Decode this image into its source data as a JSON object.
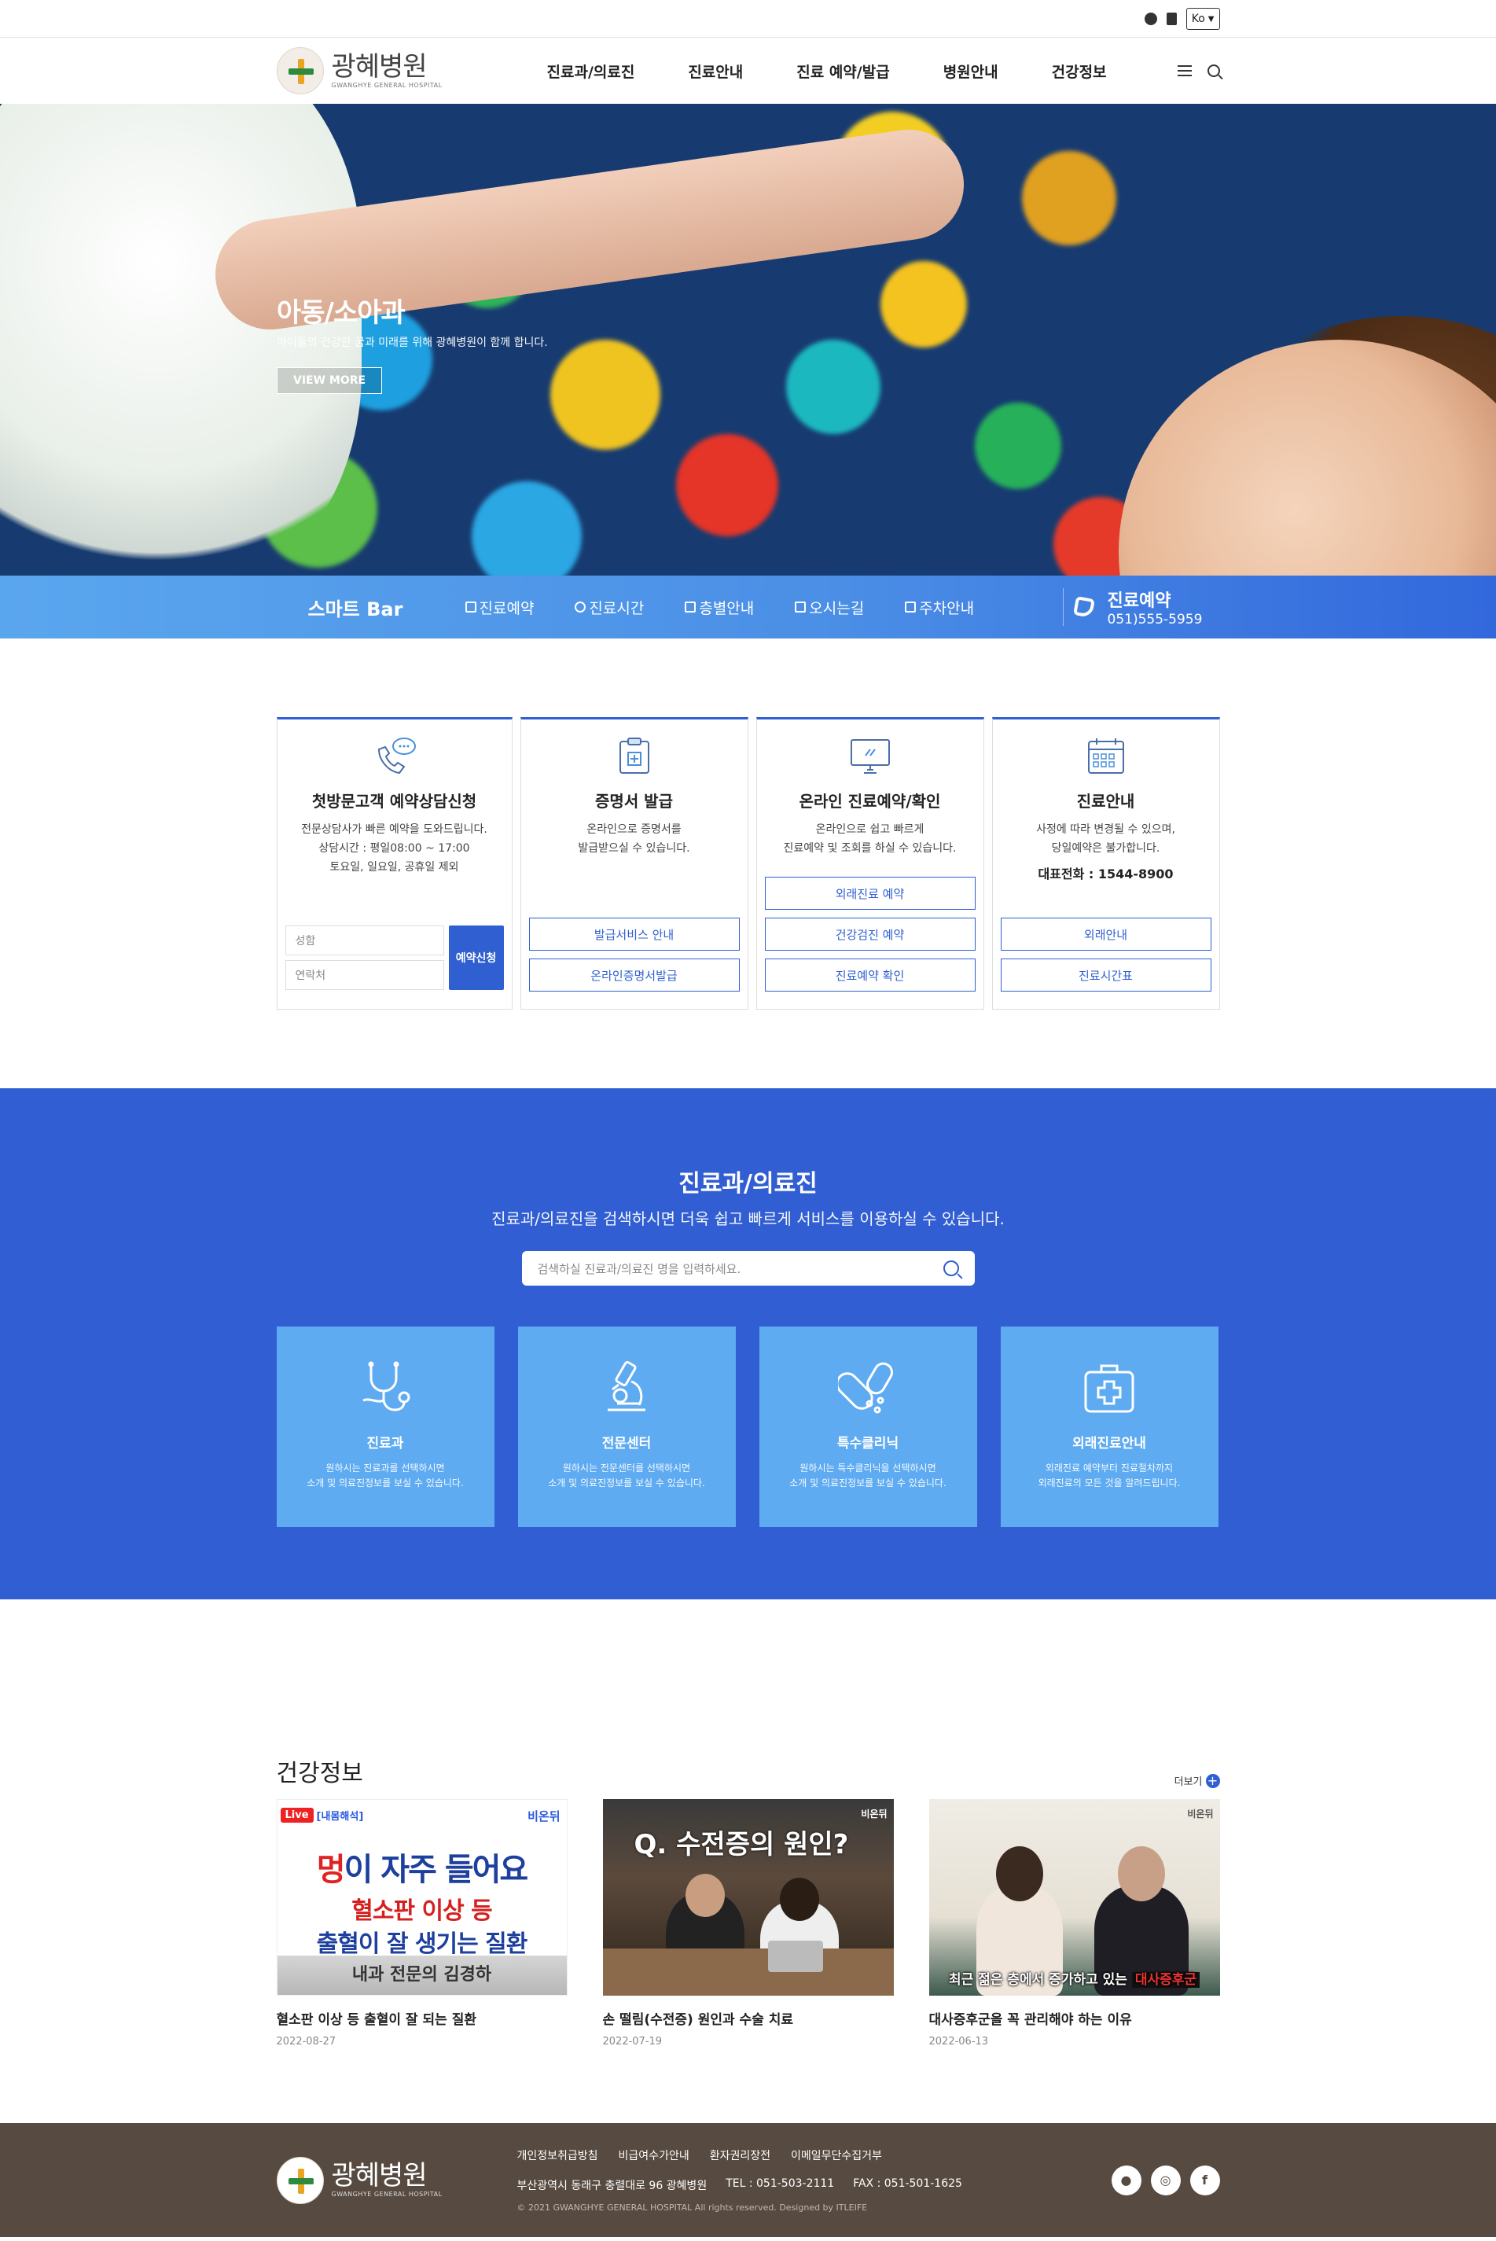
{
  "util": {
    "lang": "Ko"
  },
  "header": {
    "logo_ko": "광혜병원",
    "logo_en": "GWANGHYE GENERAL HOSPITAL",
    "nav": [
      "진료과/의료진",
      "진료안내",
      "진료 예약/발급",
      "병원안내",
      "건강정보"
    ]
  },
  "hero": {
    "title": "아동/소아과",
    "desc": "아이들의 건강한 꿈과 미래를 위해 광혜병원이 함께 합니다.",
    "button": "VIEW MORE"
  },
  "smart": {
    "title": "스마트 Bar",
    "items": [
      "진료예약",
      "진료시간",
      "층별안내",
      "오시는길",
      "주차안내"
    ],
    "phone_label": "진료예약",
    "phone_number": "051)555-5959"
  },
  "quick": {
    "c1": {
      "title": "첫방문고객 예약상담신청",
      "desc": "전문상담사가 빠른 예약을 도와드립니다.\n상담시간 : 평일08:00 ~ 17:00\n토요일, 일요일, 공휴일 제외",
      "name_ph": "성함",
      "phone_ph": "연락처",
      "submit": "예약신청"
    },
    "c2": {
      "title": "증명서 발급",
      "desc": "온라인으로 증명서를\n발급받으실 수 있습니다.",
      "btns": [
        "발급서비스 안내",
        "온라인증명서발급"
      ]
    },
    "c3": {
      "title": "온라인 진료예약/확인",
      "desc": "온라인으로 쉽고 빠르게\n진료예약 및 조회를 하실 수 있습니다.",
      "btns": [
        "외래진료 예약",
        "건강검진 예약",
        "진료예약 확인"
      ]
    },
    "c4": {
      "title": "진료안내",
      "desc": "사정에 따라 변경될 수 있으며,\n당일예약은 불가합니다.",
      "tel": "대표전화 : 1544-8900",
      "btns": [
        "외래안내",
        "진료시간표"
      ]
    }
  },
  "dept": {
    "title": "진료과/의료진",
    "sub": "진료과/의료진을 검색하시면 더욱 쉽고 빠르게 서비스를 이용하실 수 있습니다.",
    "placeholder": "검색하실 진료과/의료진 명을 입력하세요.",
    "boxes": [
      {
        "title": "진료과",
        "desc": "원하시는 진료과를 선택하시면\n소개 및 의료진정보를 보실 수 있습니다."
      },
      {
        "title": "전문센터",
        "desc": "원하시는 전문센터를 선택하시면\n소개 및 의료진정보를 보실 수 있습니다."
      },
      {
        "title": "특수클리닉",
        "desc": "원하시는 특수클리닉을 선택하시면\n소개 및 의료진정보를 보실 수 있습니다."
      },
      {
        "title": "외래진료안내",
        "desc": "외래진료 예약부터 진료절차까지\n외래진료의 모든 것을 알려드립니다."
      }
    ]
  },
  "health": {
    "title": "건강정보",
    "more": "더보기",
    "videos": [
      {
        "title": "혈소판 이상 등 출혈이 잘 되는 질환",
        "date": "2022-08-27",
        "live": "Live",
        "tag": "[내몸해석]",
        "brand": "비온뒤",
        "l1a": "멍",
        "l1b": "이 자주 들어요",
        "l2": "혈소판 이상 등",
        "l3": "출혈이 잘 생기는 질환",
        "l4": "내과 전문의 김경하"
      },
      {
        "title": "손 떨림(수전증) 원인과 수술 치료",
        "date": "2022-07-19",
        "brand": "비온뒤",
        "q": "Q. 수전증의 원인?"
      },
      {
        "title": "대사증후군을 꼭 관리해야 하는 이유",
        "date": "2022-06-13",
        "brand": "비온뒤",
        "cap_a": "최근 젊은 층에서 증가하고 있는",
        "cap_b": "대사증후군"
      }
    ]
  },
  "footer": {
    "links": [
      "개인정보취급방침",
      "비급여수가안내",
      "환자권리장전",
      "이메일무단수집거부"
    ],
    "address": "부산광역시 동래구 충렬대로 96 광혜병원",
    "tel": "TEL : 051-503-2111",
    "fax": "FAX : 051-501-1625",
    "copy": "© 2021 GWANGHYE GENERAL HOSPITAL All rights reserved. Designed by ITLEIFE",
    "sns": [
      "talk-icon",
      "instagram-icon",
      "facebook-icon"
    ]
  }
}
